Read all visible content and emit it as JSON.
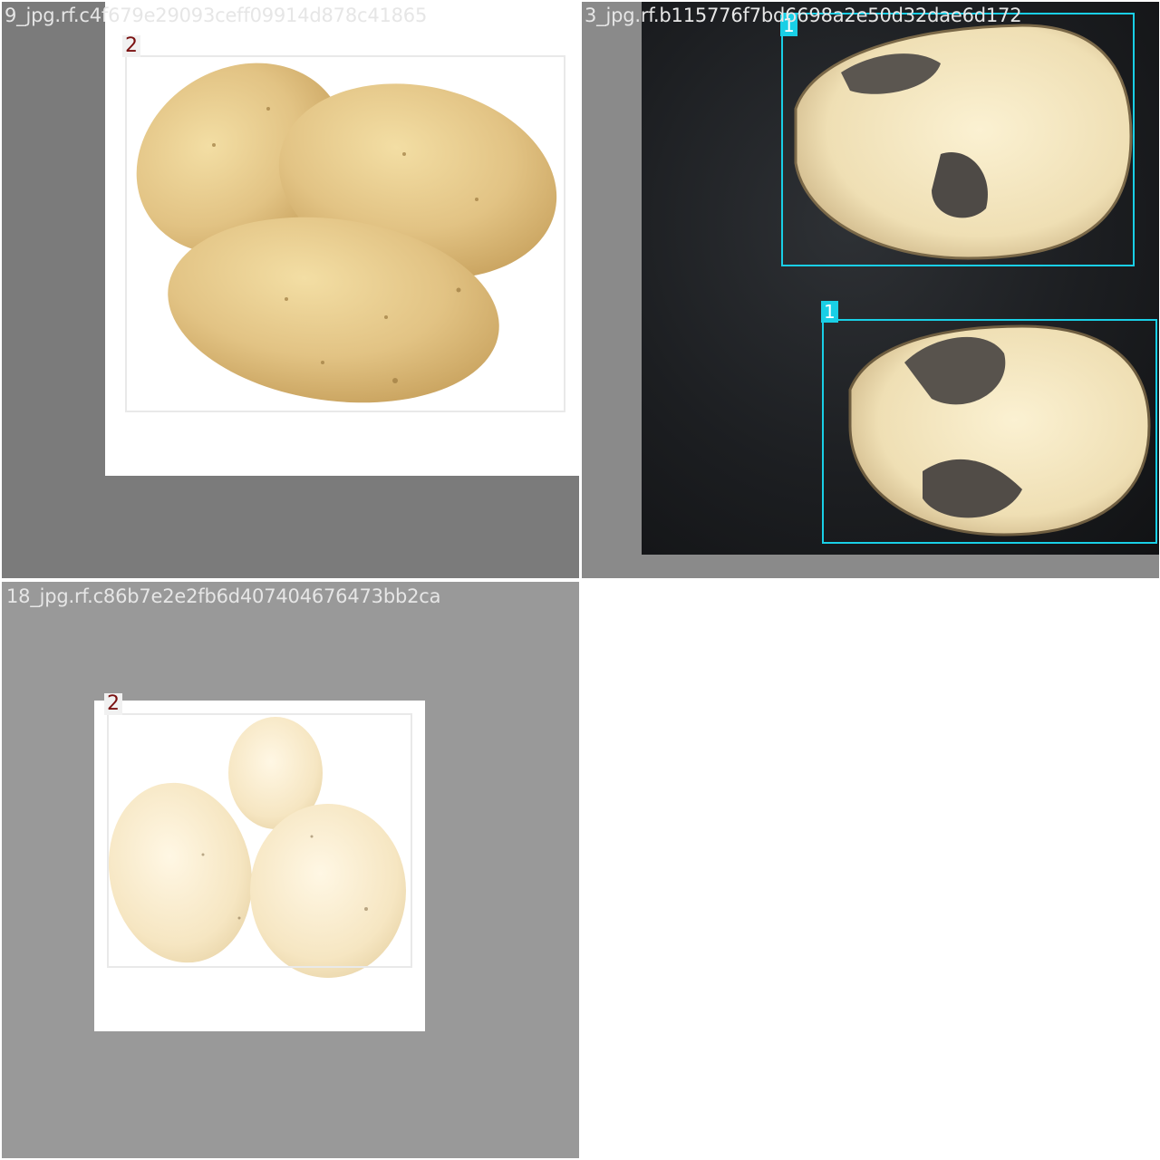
{
  "tiles": [
    {
      "caption": "9_jpg.rf.c4f679e29093ceff09914d878c41865",
      "detections": [
        {
          "class_label": "2"
        }
      ]
    },
    {
      "caption": "3_jpg.rf.b115776f7bd6698a2e50d32dae6d172",
      "detections": [
        {
          "class_label": "1"
        },
        {
          "class_label": "1"
        }
      ]
    },
    {
      "caption": "18_jpg.rf.c86b7e2e2fb6d407404676473bb2ca",
      "detections": [
        {
          "class_label": "2"
        }
      ]
    }
  ],
  "colors": {
    "label_1_box": "#19cfe6",
    "label_2_box": "#e9e9e9",
    "label_2_text": "#7a1010"
  }
}
